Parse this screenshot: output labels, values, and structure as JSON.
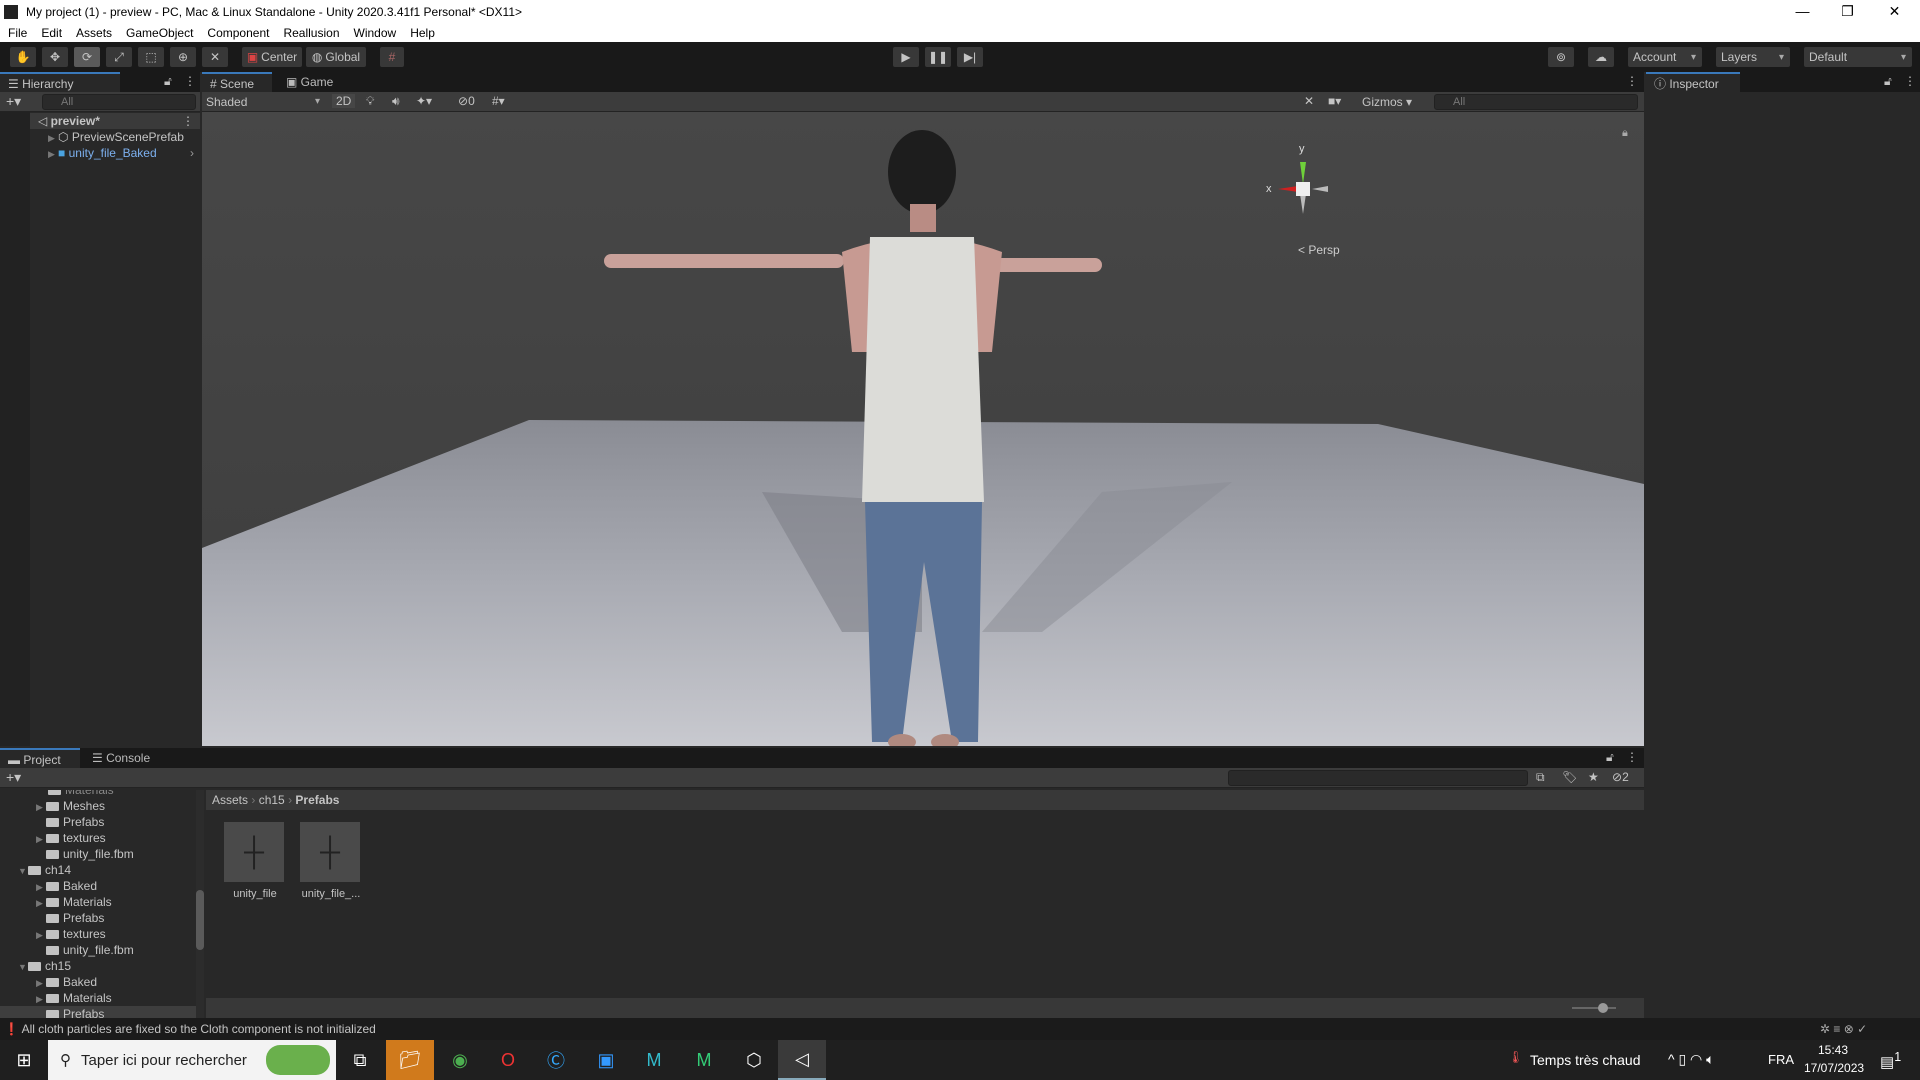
{
  "window": {
    "title": "My project (1) - preview - PC, Mac & Linux Standalone - Unity 2020.3.41f1 Personal* <DX11>",
    "minimize": "—",
    "restore": "❐",
    "close": "✕"
  },
  "menu": [
    "File",
    "Edit",
    "Assets",
    "GameObject",
    "Component",
    "Reallusion",
    "Window",
    "Help"
  ],
  "toolbar": {
    "center": "Center",
    "global": "Global",
    "account": "Account",
    "layers": "Layers",
    "layout": "Default"
  },
  "hierarchy": {
    "tab": "Hierarchy",
    "search_placeholder": "All",
    "scene": "preview*",
    "items": [
      "PreviewScenePrefab",
      "unity_file_Baked"
    ]
  },
  "scene": {
    "tabs": [
      "Scene",
      "Game"
    ],
    "shading": "Shaded",
    "mode2d": "2D",
    "hidden_count": "0",
    "gizmos": "Gizmos",
    "search_placeholder": "All",
    "axis_y": "y",
    "axis_x": "x",
    "projection": "Persp"
  },
  "inspector": {
    "tab": "Inspector"
  },
  "project": {
    "tabs": [
      "Project",
      "Console"
    ],
    "hidden_count": "2",
    "tree": [
      {
        "label": "Meshes",
        "indent": 1,
        "arrow": true
      },
      {
        "label": "Prefabs",
        "indent": 1,
        "arrow": false
      },
      {
        "label": "textures",
        "indent": 1,
        "arrow": true
      },
      {
        "label": "unity_file.fbm",
        "indent": 1,
        "arrow": false
      },
      {
        "label": "ch14",
        "indent": 0,
        "arrow": true,
        "open": true
      },
      {
        "label": "Baked",
        "indent": 1,
        "arrow": true
      },
      {
        "label": "Materials",
        "indent": 1,
        "arrow": true
      },
      {
        "label": "Prefabs",
        "indent": 1,
        "arrow": false
      },
      {
        "label": "textures",
        "indent": 1,
        "arrow": true
      },
      {
        "label": "unity_file.fbm",
        "indent": 1,
        "arrow": false
      },
      {
        "label": "ch15",
        "indent": 0,
        "arrow": true,
        "open": true
      },
      {
        "label": "Baked",
        "indent": 1,
        "arrow": true
      },
      {
        "label": "Materials",
        "indent": 1,
        "arrow": true
      },
      {
        "label": "Prefabs",
        "indent": 1,
        "arrow": false,
        "selected": true
      }
    ],
    "breadcrumb": [
      "Assets",
      "ch15",
      "Prefabs"
    ],
    "assets": [
      "unity_file",
      "unity_file_..."
    ]
  },
  "status": {
    "message": "All cloth particles are fixed so the Cloth component is not initialized"
  },
  "taskbar": {
    "search_placeholder": "Taper ici pour rechercher",
    "weather": "Temps très chaud",
    "lang": "FRA",
    "time": "15:43",
    "date": "17/07/2023",
    "notifications": "1"
  }
}
